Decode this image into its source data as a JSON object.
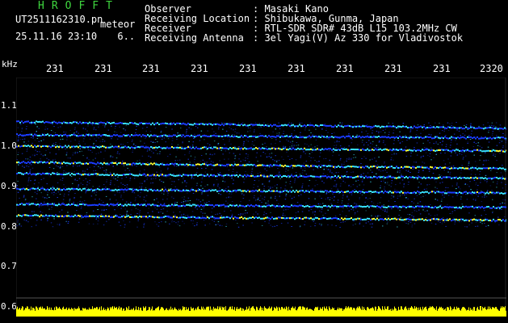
{
  "logo_text": "HROFFT",
  "file_name": "UT2511162310.pn",
  "meteor_label": "meteor",
  "datetime": "25.11.16 23:10",
  "count_label": "6..",
  "header": {
    "observer_label": "Observer",
    "observer_value": ": Masaki Kano",
    "location_label": "Receiving Location",
    "location_value": ": Shibukawa, Gunma, Japan",
    "receiver_label": "Receiver",
    "receiver_value": ": RTL-SDR SDR# 43dB L15 103.2MHz CW",
    "antenna_label": "Receiving Antenna",
    "antenna_value": ": 3el Yagi(V) Az 330 for Vladivostok"
  },
  "y_unit": "kHz",
  "x_ticks": [
    "231",
    "231",
    "231",
    "231",
    "231",
    "231",
    "231",
    "231",
    "231",
    "2320"
  ],
  "y_ticks": [
    "1.1",
    "1.0",
    "0.9",
    "0.8",
    "0.7",
    "0.6"
  ],
  "colors": {
    "background": "#000000",
    "logo": "#3fd63f",
    "signal_low": "#1a3cff",
    "signal_mid": "#39e3ff",
    "signal_high": "#ffff33",
    "noise_bar": "#ffff00"
  }
}
